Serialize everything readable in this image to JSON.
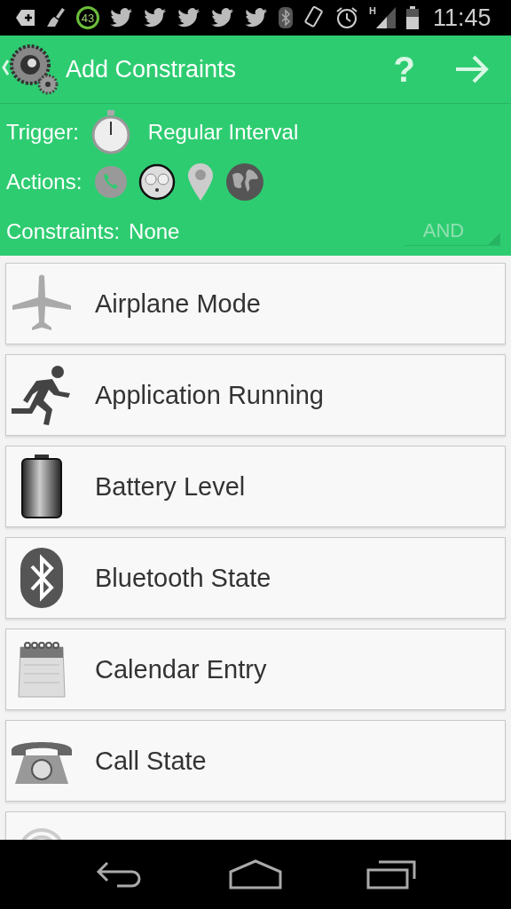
{
  "status_bar": {
    "battery_badge": "43",
    "notifications": [
      {
        "kind": "bird"
      },
      {
        "kind": "bird"
      },
      {
        "kind": "bird"
      },
      {
        "kind": "bird"
      },
      {
        "kind": "bird"
      }
    ],
    "network": "H",
    "time": "11:45"
  },
  "header": {
    "title": "Add Constraints",
    "help": "?"
  },
  "summary": {
    "trigger_label": "Trigger:",
    "trigger_value": "Regular Interval",
    "actions_label": "Actions:",
    "actions": [
      {
        "kind": "phone"
      },
      {
        "kind": "face"
      },
      {
        "kind": "pin"
      },
      {
        "kind": "globe"
      }
    ],
    "constraints_label": "Constraints:",
    "constraints_value": "None",
    "logic": "AND"
  },
  "constraints": [
    {
      "kind": "airplane",
      "label": "Airplane Mode"
    },
    {
      "kind": "running",
      "label": "Application Running"
    },
    {
      "kind": "battery",
      "label": "Battery Level"
    },
    {
      "kind": "bluetooth",
      "label": "Bluetooth State"
    },
    {
      "kind": "calendar",
      "label": "Calendar Entry"
    },
    {
      "kind": "phone",
      "label": "Call State"
    },
    {
      "kind": "signal"
    }
  ]
}
